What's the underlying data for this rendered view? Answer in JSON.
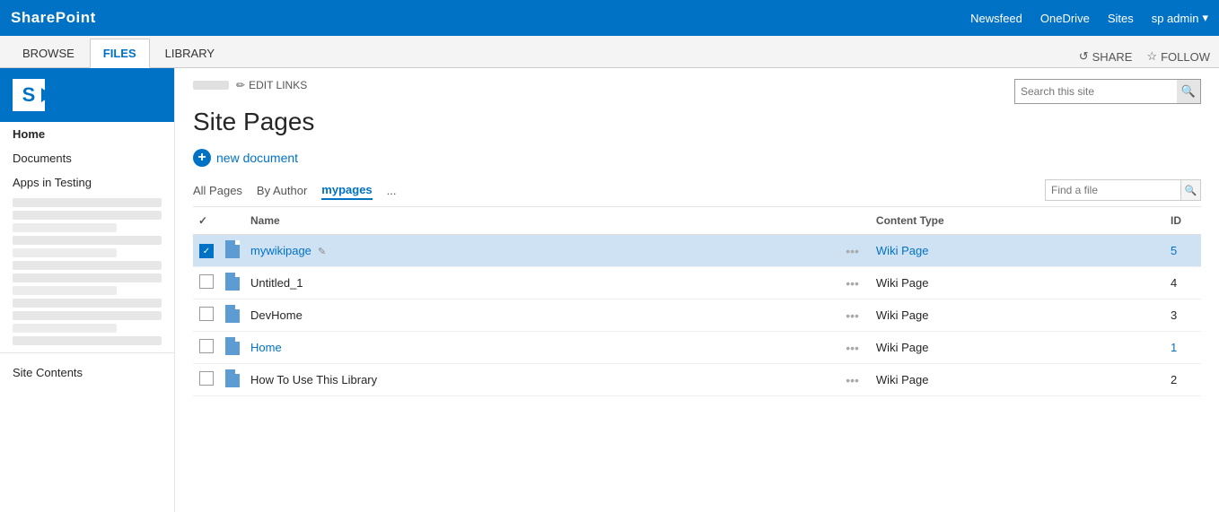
{
  "topnav": {
    "brand": "SharePoint",
    "links": [
      "Newsfeed",
      "OneDrive",
      "Sites"
    ],
    "user": "sp admin"
  },
  "ribbon": {
    "tabs": [
      "BROWSE",
      "FILES",
      "LIBRARY"
    ],
    "active_tab": "FILES",
    "actions": [
      "SHARE",
      "FOLLOW"
    ]
  },
  "search": {
    "placeholder": "Search this site"
  },
  "breadcrumb": {
    "edit_links": "EDIT LINKS"
  },
  "page": {
    "title": "Site Pages"
  },
  "new_doc_btn": "+ new document",
  "view_tabs": {
    "tabs": [
      "All Pages",
      "By Author",
      "mypages"
    ],
    "active": "mypages",
    "more": "...",
    "find_placeholder": "Find a file"
  },
  "table": {
    "columns": [
      "",
      "",
      "Name",
      "",
      "Content Type",
      "ID"
    ],
    "rows": [
      {
        "id": 1,
        "name": "mywikipage",
        "content_type": "Wiki Page",
        "row_id": "5",
        "selected": true,
        "link": false
      },
      {
        "id": 2,
        "name": "Untitled_1",
        "content_type": "Wiki Page",
        "row_id": "4",
        "selected": false,
        "link": false
      },
      {
        "id": 3,
        "name": "DevHome",
        "content_type": "Wiki Page",
        "row_id": "3",
        "selected": false,
        "link": false
      },
      {
        "id": 4,
        "name": "Home",
        "content_type": "Wiki Page",
        "row_id": "1",
        "selected": false,
        "link": true
      },
      {
        "id": 5,
        "name": "How To Use This Library",
        "content_type": "Wiki Page",
        "row_id": "2",
        "selected": false,
        "link": false
      }
    ]
  },
  "sidebar": {
    "items": [
      {
        "label": "Home",
        "active": true
      },
      {
        "label": "Documents",
        "active": false
      },
      {
        "label": "Apps in Testing",
        "active": false
      }
    ],
    "site_contents": "Site Contents"
  }
}
